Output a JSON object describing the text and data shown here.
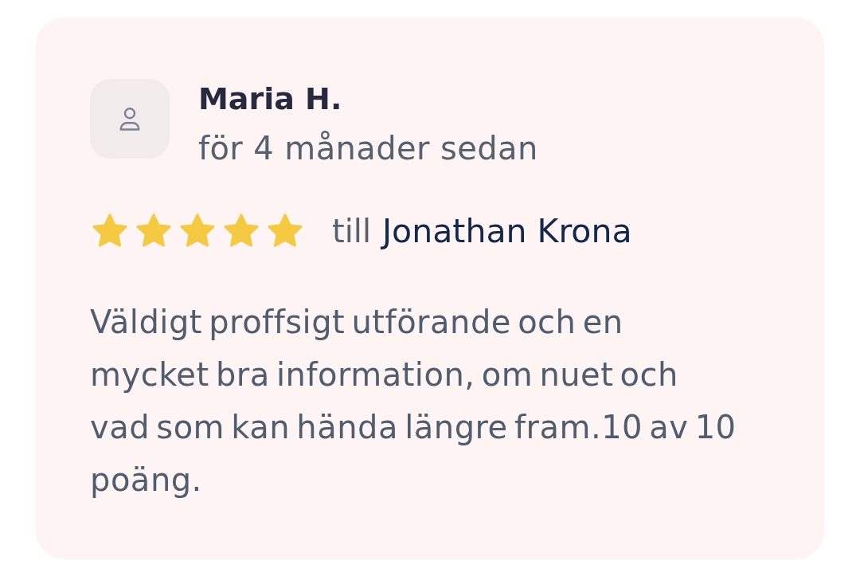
{
  "review": {
    "author": "Maria H.",
    "time": "för 4 månader sedan",
    "stars": 5,
    "recipient_prefix": "till",
    "recipient": "Jonathan Krona",
    "text": "Väldigt proffsigt utförande och en mycket bra information, om nuet och vad som kan hända längre fram.10 av 10 poäng."
  }
}
